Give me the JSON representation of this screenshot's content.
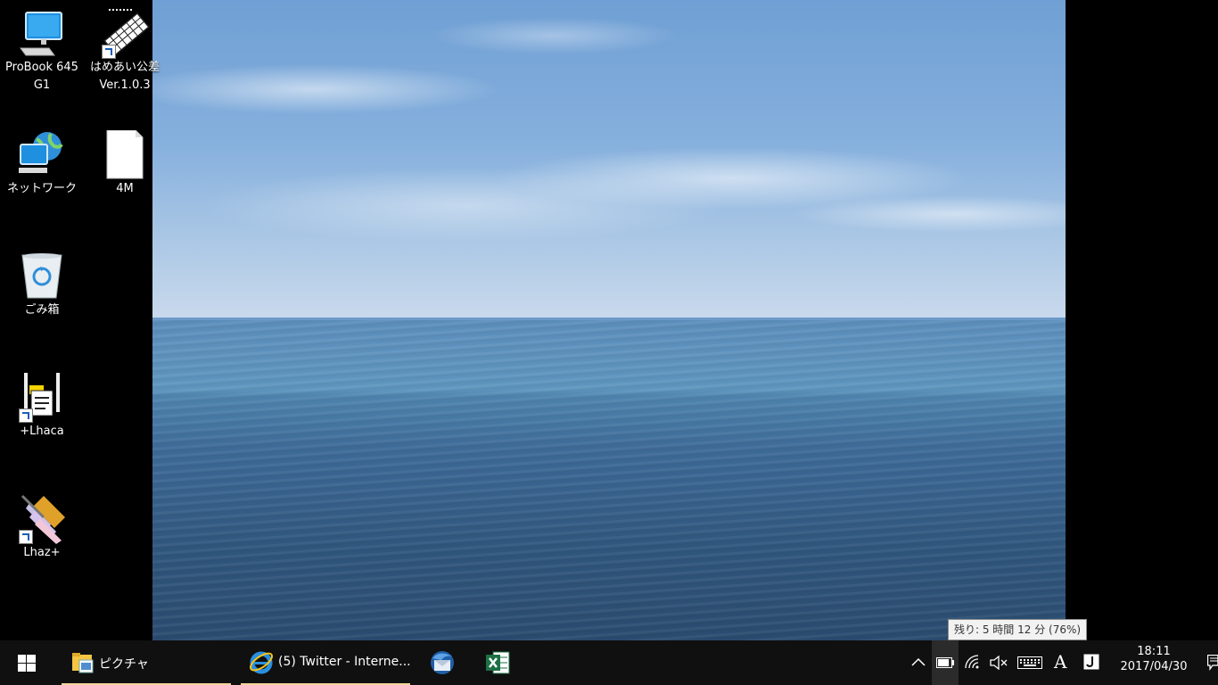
{
  "desktop": {
    "icons": [
      {
        "name": "ProBook 645\nG1",
        "icon": "computer-icon"
      },
      {
        "name": "はめあい公差\nVer.1.0.3",
        "icon": "keyboard-app-icon"
      },
      {
        "name": "ネットワーク",
        "icon": "network-icon"
      },
      {
        "name": "4M",
        "icon": "file-icon"
      },
      {
        "name": "ごみ箱",
        "icon": "recycle-bin-icon"
      },
      {
        "name": "+Lhaca",
        "icon": "lhaca-icon"
      },
      {
        "name": "Lhaz+",
        "icon": "lhaz-icon"
      }
    ]
  },
  "taskbar": {
    "start_icon": "windows-start-icon",
    "explorer_label": "ピクチャ",
    "ie_label": "(5) Twitter - Interne...",
    "thunderbird_icon": "thunderbird-icon",
    "excel_icon": "excel-icon",
    "ime_label": "A",
    "clock_time": "18:11",
    "clock_date": "2017/04/30"
  },
  "tooltip": {
    "battery_text": "残り: 5 時間 12 分 (76%)"
  },
  "colors": {
    "taskbar_bg": "#101010",
    "active_underline": "#f2d39b"
  }
}
